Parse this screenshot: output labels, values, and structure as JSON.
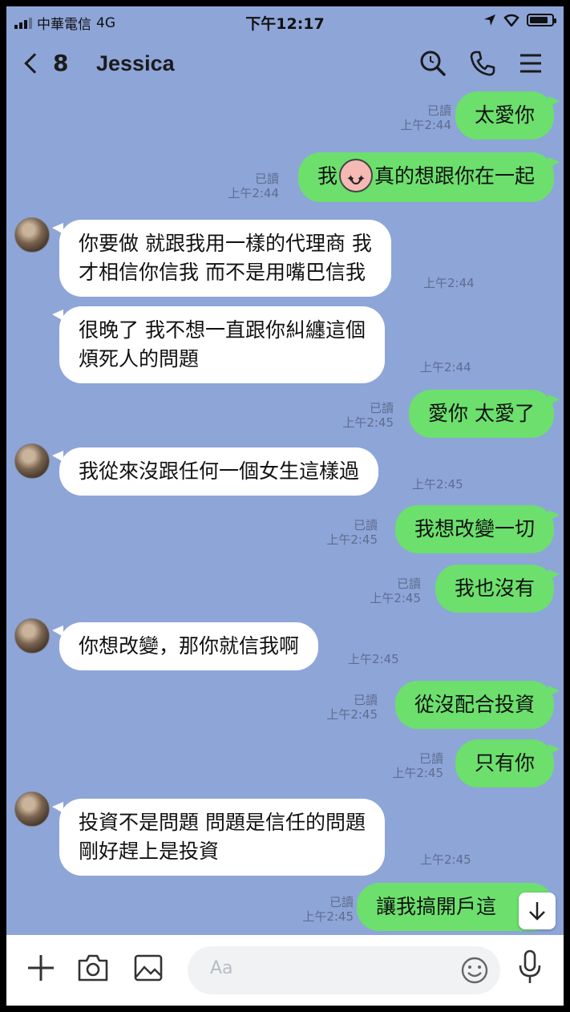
{
  "status_bar": {
    "carrier": "中華電信",
    "network": "4G",
    "time": "下午12:17",
    "battery_level": 0.85
  },
  "header": {
    "back_count": "8",
    "title": "Jessica",
    "icons": [
      "search-icon",
      "phone-icon",
      "menu-icon"
    ]
  },
  "messages": [
    {
      "dir": "out",
      "text": "太愛你",
      "read": "已讀",
      "time": "上午2:44"
    },
    {
      "dir": "out",
      "text_before": "我",
      "emoji": "sticker-emoji",
      "text_after": "真的想跟你在一起",
      "read": "已讀",
      "time": "上午2:44"
    },
    {
      "dir": "in",
      "lines": [
        "你要做 就跟我用一樣的代理商 我",
        "才相信你信我 而不是用嘴巴信我"
      ],
      "time": "上午2:44"
    },
    {
      "dir": "in",
      "lines": [
        "很晚了 我不想一直跟你糾纏這個",
        "煩死人的問題"
      ],
      "time": "上午2:44"
    },
    {
      "dir": "out",
      "text": "愛你 太愛了",
      "read": "已讀",
      "time": "上午2:45"
    },
    {
      "dir": "in",
      "lines": [
        "我從來沒跟任何一個女生這樣過"
      ],
      "time": "上午2:45"
    },
    {
      "dir": "out",
      "text": "我想改變一切",
      "read": "已讀",
      "time": "上午2:45"
    },
    {
      "dir": "out",
      "text": "我也沒有",
      "read": "已讀",
      "time": "上午2:45"
    },
    {
      "dir": "in",
      "lines": [
        "你想改變，那你就信我啊"
      ],
      "time": "上午2:45"
    },
    {
      "dir": "out",
      "text": "從沒配合投資",
      "read": "已讀",
      "time": "上午2:45"
    },
    {
      "dir": "out",
      "text": "只有你",
      "read": "已讀",
      "time": "上午2:45"
    },
    {
      "dir": "in",
      "lines": [
        "投資不是問題 問題是信任的問題",
        "剛好趕上是投資"
      ],
      "time": "上午2:45"
    },
    {
      "dir": "out",
      "text": "讓我搞開戶這",
      "read": "已讀",
      "time": "上午2:45"
    }
  ],
  "footer": {
    "input_placeholder": "Aa",
    "icons": [
      "plus-icon",
      "camera-icon",
      "image-icon",
      "smile-icon",
      "mic-icon"
    ]
  },
  "colors": {
    "background": "#8ea5d8",
    "outgoing_bubble": "#6cdf6d",
    "incoming_bubble": "#ffffff"
  }
}
